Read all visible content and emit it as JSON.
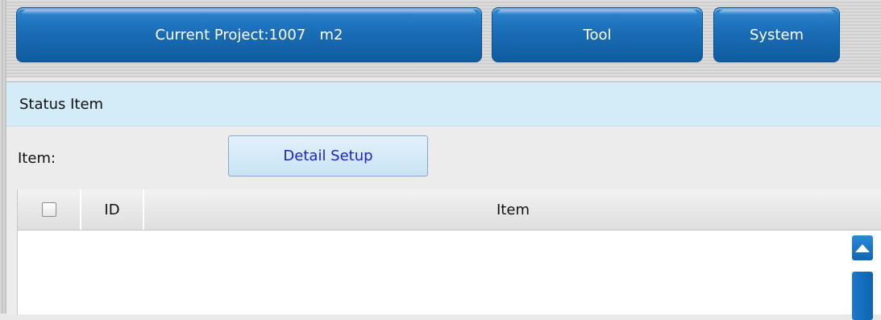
{
  "nav": {
    "project_label": "Current Project:1007   m2",
    "tool_label": "Tool",
    "system_label": "System"
  },
  "section": {
    "title": "Status Item"
  },
  "item_row": {
    "label": "Item:",
    "detail_button": "Detail Setup"
  },
  "table": {
    "columns": [
      "",
      "ID",
      "Item"
    ],
    "rows": []
  },
  "colors": {
    "nav_button": "#1a6db6",
    "header_bg": "#d4ebf8",
    "detail_text": "#1a23c8",
    "scroll": "#0f66b5"
  },
  "icons": {
    "scroll_up": "triangle-up-icon"
  }
}
